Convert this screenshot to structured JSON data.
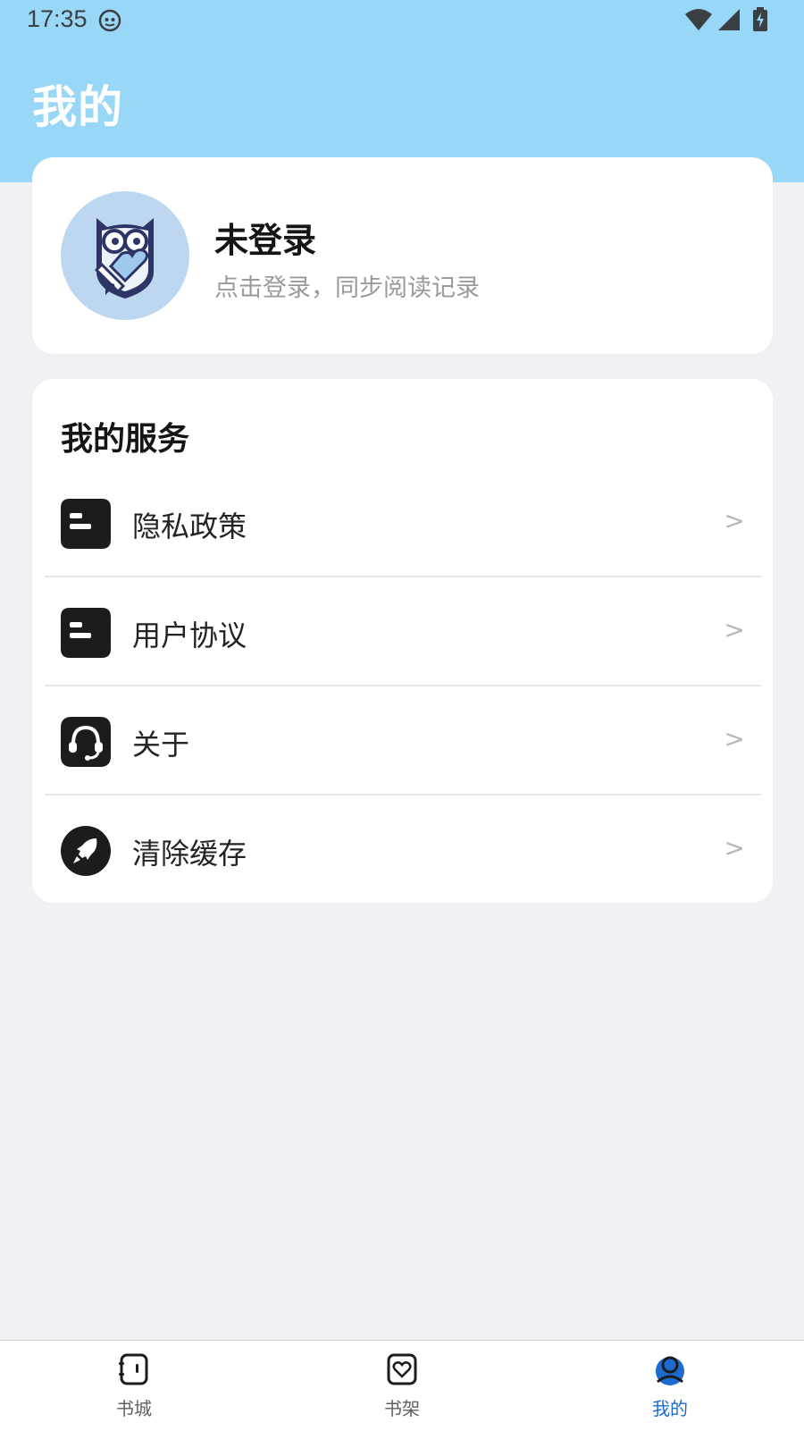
{
  "status_bar": {
    "time": "17:35",
    "icons": [
      "app-notification-icon",
      "wifi-icon",
      "cellular-signal-icon",
      "battery-charging-icon"
    ]
  },
  "header": {
    "title": "我的",
    "background_color": "#98d7f6"
  },
  "profile": {
    "name": "未登录",
    "subtitle": "点击登录，同步阅读记录",
    "avatar_icon": "owl-book-icon"
  },
  "services": {
    "title": "我的服务",
    "items": [
      {
        "label": "隐私政策",
        "icon": "document-icon",
        "chevron": ">"
      },
      {
        "label": "用户协议",
        "icon": "document-icon",
        "chevron": ">"
      },
      {
        "label": "关于",
        "icon": "headset-icon",
        "chevron": ">"
      },
      {
        "label": "清除缓存",
        "icon": "rocket-icon",
        "chevron": ">"
      }
    ]
  },
  "bottom_nav": {
    "items": [
      {
        "label": "书城",
        "icon": "book-store-icon",
        "active": false
      },
      {
        "label": "书架",
        "icon": "bookshelf-heart-icon",
        "active": false
      },
      {
        "label": "我的",
        "icon": "person-icon",
        "active": true
      }
    ],
    "active_color": "#1e6bd0"
  }
}
